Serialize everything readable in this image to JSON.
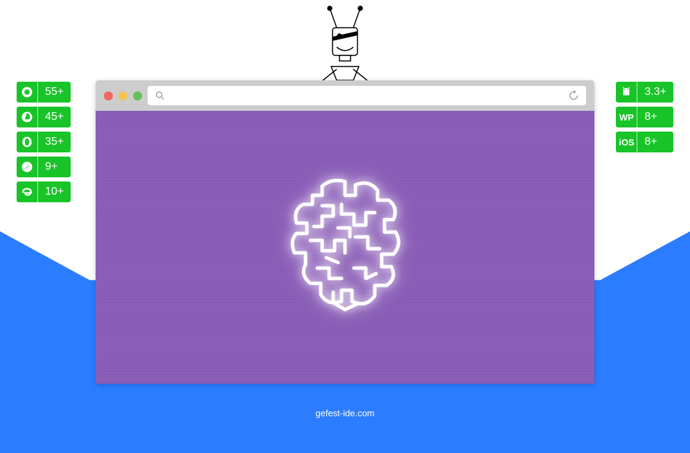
{
  "compat_left": [
    {
      "icon": "chrome",
      "version": "55+"
    },
    {
      "icon": "firefox",
      "version": "45+"
    },
    {
      "icon": "opera",
      "version": "35+"
    },
    {
      "icon": "safari",
      "version": "9+"
    },
    {
      "icon": "ie",
      "version": "10+"
    }
  ],
  "compat_right": [
    {
      "icon": "android",
      "label": "",
      "version": "3.3+"
    },
    {
      "icon": "wp",
      "label": "WP",
      "version": "8+"
    },
    {
      "icon": "ios",
      "label": "iOS",
      "version": "8+"
    }
  ],
  "footer": {
    "url": "gefest-ide.com"
  },
  "colors": {
    "badge_green": "#18c428",
    "bg_blue": "#2b7cff",
    "content_purple": "#8b5eb8"
  }
}
